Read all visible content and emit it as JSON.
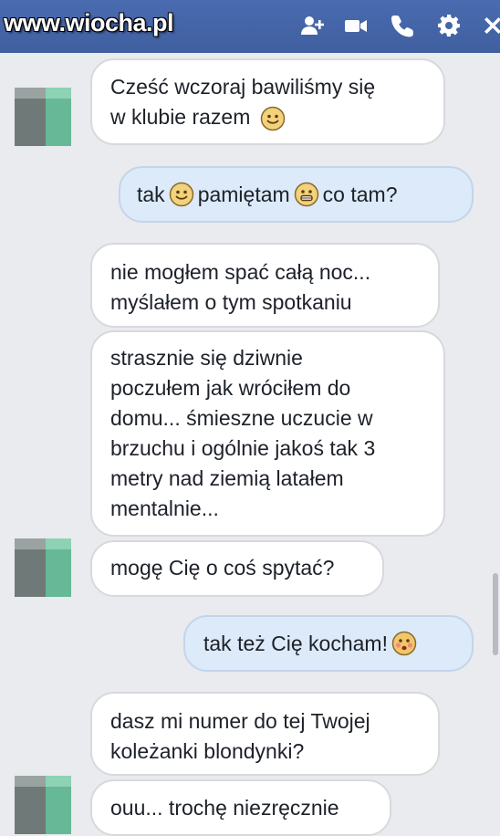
{
  "watermark": "www.wiocha.pl",
  "header": {
    "icons": [
      "add-person-icon",
      "video-camera-icon",
      "phone-icon",
      "gear-icon",
      "close-icon"
    ],
    "bg_color": "#4267b2"
  },
  "messages": [
    {
      "side": "in",
      "lines": [
        "Cześć wczoraj bawiliśmy się",
        "w klubie razem"
      ],
      "emoji": "smile"
    },
    {
      "side": "out",
      "parts": [
        "tak",
        "pamiętam",
        "co tam?"
      ]
    },
    {
      "side": "in",
      "lines": [
        "nie mogłem spać całą noc...",
        "myślałem o tym spotkaniu"
      ]
    },
    {
      "side": "in",
      "lines": [
        "strasznie się dziwnie",
        "poczułem jak wróciłem do",
        "domu... śmieszne uczucie w",
        "brzuchu i ogólnie jakoś tak 3",
        "metry nad ziemią latałem",
        "mentalnie..."
      ]
    },
    {
      "side": "in",
      "lines": [
        "mogę Cię o coś spytać?"
      ]
    },
    {
      "side": "out",
      "parts": [
        "tak też Cię kocham!"
      ],
      "emoji": "blush"
    },
    {
      "side": "in",
      "lines": [
        "dasz mi numer do tej Twojej",
        "koleżanki blondynki?"
      ]
    },
    {
      "side": "in",
      "lines": [
        "ouu... trochę niezręcznie"
      ]
    }
  ],
  "colors": {
    "incoming_bubble": "#ffffff",
    "outgoing_bubble": "#dceaf9",
    "background": "#e9ebee"
  }
}
